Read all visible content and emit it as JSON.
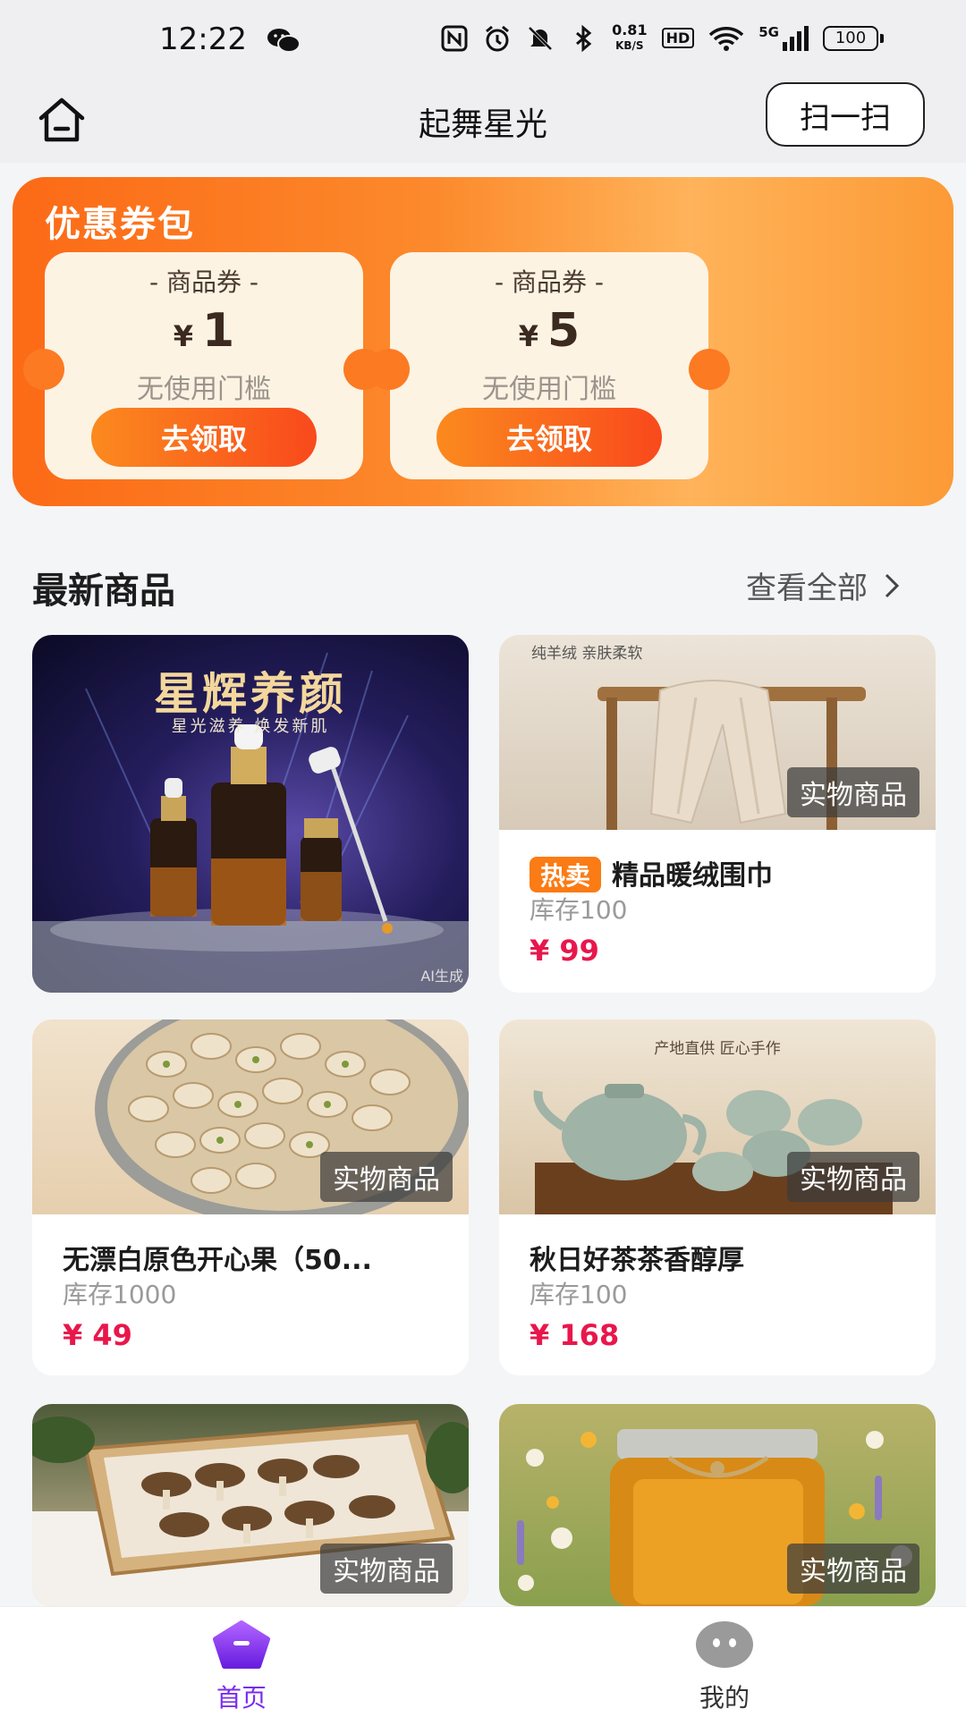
{
  "status_bar": {
    "time": "12:22",
    "net_speed_value": "0.81",
    "net_speed_unit": "KB/S",
    "hd": "HD",
    "signal": "5G",
    "battery": "100"
  },
  "header": {
    "title": "起舞星光",
    "scan_label": "扫一扫"
  },
  "coupon_pack": {
    "title": "优惠券包",
    "coupons": [
      {
        "type": "- 商品券 -",
        "currency": "¥",
        "amount": "1",
        "condition": "无使用门槛",
        "button": "去领取"
      },
      {
        "type": "- 商品券 -",
        "currency": "¥",
        "amount": "5",
        "condition": "无使用门槛",
        "button": "去领取"
      }
    ]
  },
  "latest": {
    "title": "最新商品",
    "view_all": "查看全部"
  },
  "products": [
    {
      "image_title": "星辉养颜",
      "image_subtitle": "星光滋养 焕发新肌",
      "image_badge": "AI生成"
    },
    {
      "image_caption": "纯羊绒 亲肤柔软",
      "tag": "实物商品",
      "hot_badge": "热卖",
      "name": "精品暖绒围巾",
      "stock": "库存100",
      "price": "¥ 99"
    },
    {
      "tag": "实物商品",
      "name": "无漂白原色开心果（50...",
      "stock": "库存1000",
      "price": "¥ 49"
    },
    {
      "image_caption": "产地直供 匠心手作",
      "tag": "实物商品",
      "name": "秋日好茶茶香醇厚",
      "stock": "库存100",
      "price": "¥ 168"
    },
    {
      "tag": "实物商品"
    },
    {
      "tag": "实物商品"
    }
  ],
  "bottom_nav": [
    {
      "label": "首页",
      "active": true,
      "color": "#7a2cf0"
    },
    {
      "label": "我的",
      "active": false,
      "color": "#333333"
    }
  ],
  "colors": {
    "accent_orange": "#fc7a22",
    "price_red": "#e8174b",
    "active_purple": "#7a2cf0"
  }
}
